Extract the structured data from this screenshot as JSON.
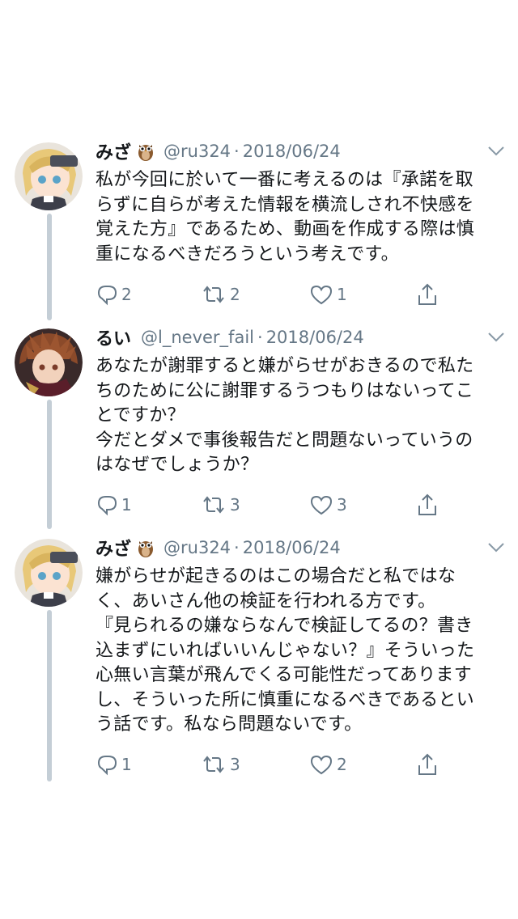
{
  "tweets": [
    {
      "name": "みざ",
      "handle": "@ru324",
      "dot": "·",
      "date": "2018/06/24",
      "avatar": "anime-girl-avatar",
      "text": "私が今回に於いて一番に考えるのは『承諾を取\nらずに自らが考えた情報を横流しされ不快感を\n覚えた方』であるため、動画を作成する際は慎\n重になるべきだろうという考えです。",
      "replies": "2",
      "retweets": "2",
      "likes": "1"
    },
    {
      "name": "るい",
      "handle": "@l_never_fail",
      "dot": "·",
      "date": "2018/06/24",
      "avatar": "anime-boy-avatar",
      "text": "あなたが謝罪すると嫌がらせがおきるので私た\nちのために公に謝罪するうつもりはないってこ\nとですか？\n今だとダメで事後報告だと問題ないっていうの\nはなぜでしょうか？",
      "replies": "1",
      "retweets": "3",
      "likes": "3"
    },
    {
      "name": "みざ",
      "handle": "@ru324",
      "dot": "·",
      "date": "2018/06/24",
      "avatar": "anime-girl-avatar",
      "text": "嫌がらせが起きるのはこの場合だと私ではな\nく、あいさん他の検証を行われる方です。\n『見られるの嫌ならなんで検証してるの？書き\n込まずにいればいいんじゃない？』そういった\n心無い言葉が飛んでくる可能性だってあります\nし、そういった所に慎重になるべきであるとい\nう話です。私なら問題ないです。",
      "replies": "1",
      "retweets": "3",
      "likes": "2"
    }
  ],
  "colors": {
    "text": "#14171a",
    "secondary": "#657786",
    "thread_line": "#c4ced6"
  },
  "icons": [
    "owl-emoji-icon",
    "chevron-down-icon",
    "reply-icon",
    "retweet-icon",
    "like-icon",
    "share-icon"
  ]
}
